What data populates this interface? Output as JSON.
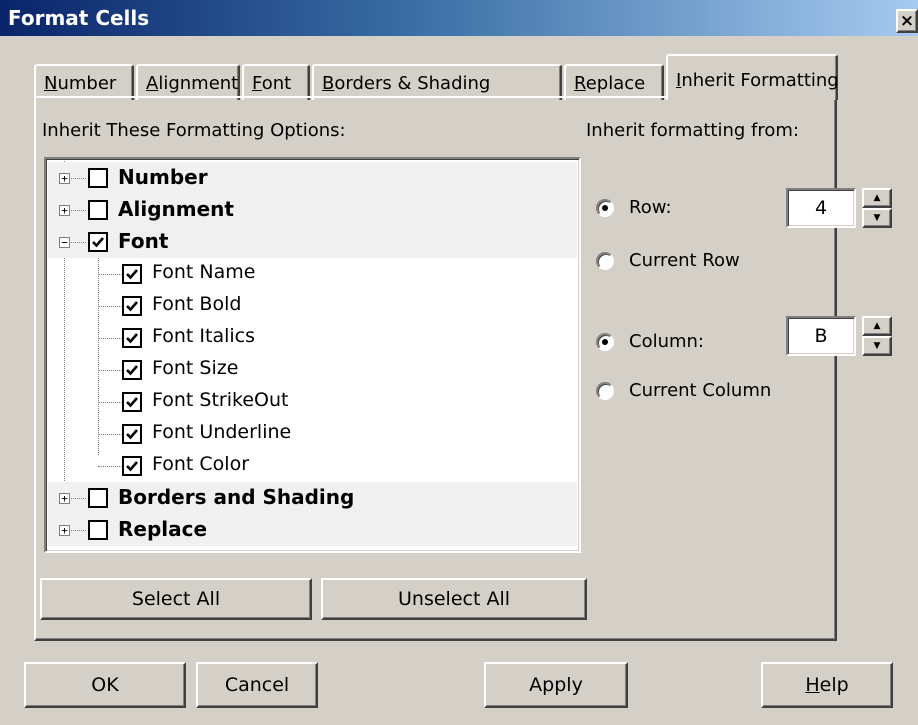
{
  "window": {
    "title": "Format Cells",
    "close_glyph": "×"
  },
  "tabs": [
    {
      "pre": "",
      "ul": "N",
      "post": "umber"
    },
    {
      "pre": "",
      "ul": "A",
      "post": "lignment"
    },
    {
      "pre": "",
      "ul": "F",
      "post": "ont"
    },
    {
      "pre": "",
      "ul": "B",
      "post": "orders & Shading"
    },
    {
      "pre": "",
      "ul": "R",
      "post": "eplace"
    },
    {
      "pre": "",
      "ul": "I",
      "post": "nherit Formatting"
    }
  ],
  "active_tab": 5,
  "left": {
    "heading": "Inherit These Formatting Options:",
    "tree": [
      {
        "label": "Number",
        "level": 0,
        "checked": false,
        "expanded": false
      },
      {
        "label": "Alignment",
        "level": 0,
        "checked": false,
        "expanded": false
      },
      {
        "label": "Font",
        "level": 0,
        "checked": true,
        "expanded": true
      },
      {
        "label": "Font Name",
        "level": 1,
        "checked": true
      },
      {
        "label": "Font Bold",
        "level": 1,
        "checked": true
      },
      {
        "label": "Font Italics",
        "level": 1,
        "checked": true
      },
      {
        "label": "Font Size",
        "level": 1,
        "checked": true
      },
      {
        "label": "Font StrikeOut",
        "level": 1,
        "checked": true
      },
      {
        "label": "Font Underline",
        "level": 1,
        "checked": true
      },
      {
        "label": "Font Color",
        "level": 1,
        "checked": true
      },
      {
        "label": "Borders and Shading",
        "level": 0,
        "checked": false,
        "expanded": false
      },
      {
        "label": "Replace",
        "level": 0,
        "checked": false,
        "expanded": false
      }
    ],
    "select_all": "Select All",
    "unselect_all": "Unselect All"
  },
  "right": {
    "heading": "Inherit formatting from:",
    "row_label": "Row:",
    "row_value": "4",
    "current_row_label": "Current Row",
    "column_label": "Column:",
    "column_value": "B",
    "current_column_label": "Current Column",
    "row_mode": "Row",
    "column_mode": "Column"
  },
  "footer": {
    "ok": "OK",
    "cancel": "Cancel",
    "apply": "Apply",
    "help_ul": "H",
    "help_post": "elp"
  },
  "colors": {
    "face": "#d4d0c8",
    "title_start": "#0a246a",
    "title_end": "#a6caf0"
  }
}
